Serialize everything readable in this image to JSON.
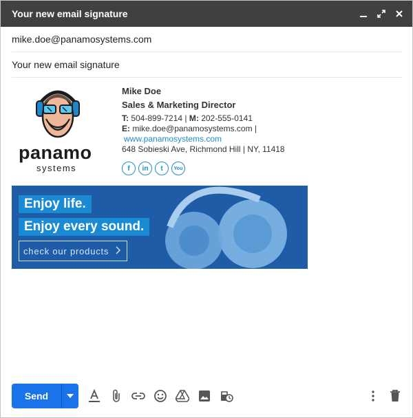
{
  "window": {
    "title": "Your new email signature",
    "buttons": [
      "minimize-icon",
      "expand-icon",
      "close-icon"
    ]
  },
  "fields": {
    "to": "mike.doe@panamosystems.com",
    "subject": "Your new email signature"
  },
  "signature": {
    "logo_text": "panamo",
    "logo_sub": "systems",
    "name": "Mike Doe",
    "role": "Sales & Marketing Director",
    "phone_label": "T:",
    "phone": " 504-899-7214 | ",
    "mobile_label": "M:",
    "mobile": " 202-555-0141",
    "email_label": "E:",
    "email": " mike.doe@panamosystems.com |",
    "website": "www.panamosystems.com",
    "address": "648 Sobieski Ave, Richmond Hill | NY, 11418",
    "socials": [
      {
        "icon": "facebook-icon",
        "glyph": "f"
      },
      {
        "icon": "linkedin-icon",
        "glyph": "in"
      },
      {
        "icon": "twitter-icon",
        "glyph": "t"
      },
      {
        "icon": "youtube-icon",
        "glyph": "You"
      }
    ]
  },
  "banner": {
    "line1": "Enjoy life.",
    "line2": "Enjoy every sound.",
    "cta": "check our products"
  },
  "toolbar": {
    "send": "Send",
    "tools": [
      "text-format-icon",
      "attach-icon",
      "link-icon",
      "emoji-icon",
      "drive-icon",
      "image-icon",
      "schedule-icon"
    ],
    "right": [
      "more-options-icon",
      "trash-icon"
    ]
  },
  "colors": {
    "titlebar": "#404040",
    "send": "#1a73e8",
    "banner": "#1f5ca8",
    "accent": "#1f8bc9"
  }
}
